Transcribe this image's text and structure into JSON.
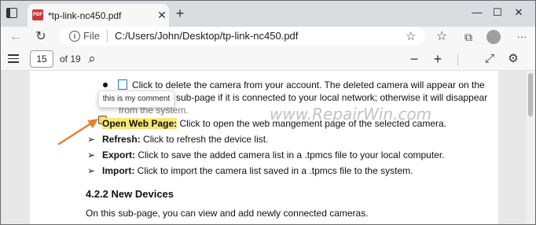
{
  "tab": {
    "title": "*tp-link-nc450.pdf",
    "favicon_label": "PDF",
    "close_glyph": "✕",
    "new_tab_glyph": "+"
  },
  "window": {
    "minimize": "—",
    "maximize": "☐",
    "close": "✕"
  },
  "nav": {
    "back": "←",
    "refresh": "↻"
  },
  "address": {
    "scheme_label": "File",
    "url": "C:/Users/John/Desktop/tp-link-nc450.pdf",
    "info_glyph": "i",
    "star_glyph": "☆"
  },
  "toolbar_right": {
    "favorites_glyph": "☆",
    "collections_glyph": "⧉",
    "more_glyph": "···"
  },
  "pdf": {
    "page_number": "15",
    "page_count": "of 19",
    "search_glyph": "⌕",
    "zoom_out": "−",
    "zoom_in": "+",
    "fit_glyph": "⤢",
    "settings_glyph": "⚙"
  },
  "document": {
    "line1": "Click to delete the camera from your account. The deleted camera will appear on the",
    "line2": "sub-page if it is connected to your local network; otherwise it will disappear",
    "line3": "from the system.",
    "bullets": [
      {
        "term": "Open Web Page:",
        "text": " Click to open the web mangement page of the selected camera."
      },
      {
        "term": "Refresh:",
        "text": " Click to refresh the device list."
      },
      {
        "term": "Export:",
        "text": " Click to save the added camera list in a .tpmcs file to your local computer."
      },
      {
        "term": "Import:",
        "text": " Click to import the camera list saved in a .tpmcs file to the system."
      }
    ],
    "section_heading": "4.2.2   New Devices",
    "paragraph": "On this sub-page, you can view and add newly connected cameras.",
    "comment_tooltip": "this is my comment",
    "watermark": "www.RepairWin.com"
  },
  "colors": {
    "highlight": "#fbe774",
    "arrow": "#ef7d2d",
    "tab_strip": "#d9dce0"
  }
}
